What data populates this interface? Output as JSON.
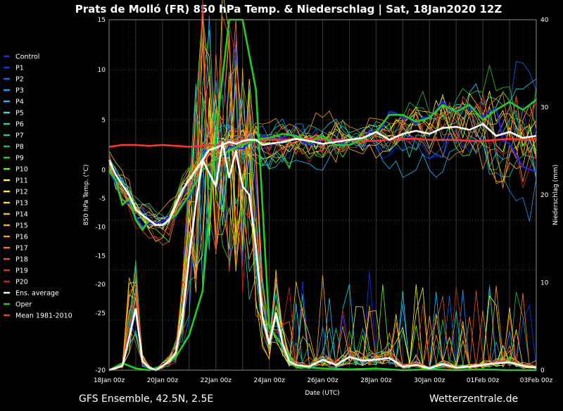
{
  "chart_data": {
    "type": "line",
    "title": "Prats de Molló  (FR)  850 hPa Temp. & Niederschlag | Sat, 18Jan2020 12Z",
    "xlabel": "Date (UTC)",
    "ylabel": "850 hPa Temp. (°C)",
    "y2label": "Niederschlag (mm)",
    "x_ticks": [
      "18Jan 00z",
      "20Jan 00z",
      "22Jan 00z",
      "24Jan 00z",
      "26Jan 00z",
      "28Jan 00z",
      "30Jan 00z",
      "01Feb 00z",
      "03Feb 00z"
    ],
    "x_tick_days": [
      0,
      2,
      4,
      6,
      8,
      10,
      12,
      14,
      16
    ],
    "xlim_days": [
      0,
      16
    ],
    "ylim": [
      -20,
      15
    ],
    "y_ticks": [
      15,
      10,
      5,
      0,
      -5,
      -10,
      -15,
      -20,
      -25,
      -20
    ],
    "y2lim": [
      0,
      40
    ],
    "y2_ticks": [
      0,
      10,
      20,
      30,
      40
    ],
    "grid": true,
    "legend_position": "left",
    "footer_left": "GFS Ensemble, 42.5N, 2.5E",
    "footer_right": "Wetterzentrale.de",
    "series": [
      {
        "name": "Control",
        "color": "#2222ee",
        "width": 2.6
      },
      {
        "name": "P1",
        "color": "#1133ff",
        "width": 0.9
      },
      {
        "name": "P2",
        "color": "#1166ff",
        "width": 0.9
      },
      {
        "name": "P3",
        "color": "#2299ff",
        "width": 0.9
      },
      {
        "name": "P4",
        "color": "#22bbff",
        "width": 0.9
      },
      {
        "name": "P5",
        "color": "#22ddee",
        "width": 0.9
      },
      {
        "name": "P6",
        "color": "#22ddaa",
        "width": 0.9
      },
      {
        "name": "P7",
        "color": "#22cc88",
        "width": 0.9
      },
      {
        "name": "P8",
        "color": "#22bb55",
        "width": 0.9
      },
      {
        "name": "P9",
        "color": "#33cc33",
        "width": 0.9
      },
      {
        "name": "P10",
        "color": "#66ff22",
        "width": 0.9
      },
      {
        "name": "P11",
        "color": "#ffff22",
        "width": 0.9
      },
      {
        "name": "P12",
        "color": "#ffee22",
        "width": 0.9
      },
      {
        "name": "P13",
        "color": "#ffdd22",
        "width": 0.9
      },
      {
        "name": "P14",
        "color": "#ffbb22",
        "width": 0.9
      },
      {
        "name": "P15",
        "color": "#ffaa22",
        "width": 0.9
      },
      {
        "name": "P16",
        "color": "#ff9922",
        "width": 0.9
      },
      {
        "name": "P17",
        "color": "#ff7722",
        "width": 0.9
      },
      {
        "name": "P18",
        "color": "#ee5522",
        "width": 0.9
      },
      {
        "name": "P19",
        "color": "#dd3322",
        "width": 0.9
      },
      {
        "name": "P20",
        "color": "#cc2222",
        "width": 0.9
      },
      {
        "name": "Ens. average",
        "color": "#ffffff",
        "width": 2.6
      },
      {
        "name": "Oper",
        "color": "#22cc22",
        "width": 2.6
      },
      {
        "name": "Mean 1981-2010",
        "color": "#ff3333",
        "width": 2.6
      }
    ],
    "mean_temp": {
      "x": [
        0,
        0.5,
        1,
        1.5,
        2,
        2.5,
        3,
        3.5,
        4,
        4.5,
        5,
        5.5,
        6,
        6.5,
        7,
        7.5,
        8,
        8.5,
        9,
        9.5,
        10,
        10.5,
        11,
        11.5,
        12,
        12.5,
        13,
        13.5,
        14,
        14.5,
        15,
        15.5,
        16
      ],
      "y": [
        2.3,
        2.5,
        2.5,
        2.4,
        2.5,
        2.4,
        2.3,
        2.4,
        2.5,
        2.6,
        2.8,
        2.9,
        3.0,
        3.0,
        3.1,
        3.1,
        3.0,
        3.0,
        3.0,
        2.9,
        2.9,
        3.0,
        3.1,
        3.1,
        3.0,
        3.0,
        3.0,
        2.9,
        2.9,
        3.0,
        3.1,
        3.0,
        3.1
      ]
    },
    "ens_avg_temp": {
      "x": [
        0,
        0.25,
        0.5,
        0.75,
        1,
        1.25,
        1.5,
        1.75,
        2,
        2.25,
        2.5,
        2.75,
        3,
        3.25,
        3.5,
        3.75,
        4,
        4.25,
        4.5,
        4.75,
        5,
        5.25,
        5.5,
        5.75,
        6,
        6.5,
        7,
        7.5,
        8,
        8.5,
        9,
        9.5,
        10,
        10.5,
        11,
        11.5,
        12,
        12.5,
        13,
        13.5,
        14,
        14.5,
        15,
        15.5,
        16
      ],
      "y": [
        1.0,
        -0.5,
        -1.5,
        -2.5,
        -4.0,
        -4.5,
        -5.0,
        -5.5,
        -5.5,
        -5.0,
        -3.5,
        -2.0,
        -1.0,
        0.0,
        1.0,
        2.0,
        2.2,
        2.5,
        2.8,
        2.6,
        2.9,
        3.0,
        3.0,
        2.5,
        2.6,
        2.8,
        3.1,
        2.9,
        2.6,
        2.8,
        3.0,
        3.2,
        3.8,
        3.0,
        3.6,
        3.9,
        3.6,
        4.2,
        4.3,
        4.0,
        4.6,
        3.4,
        3.8,
        3.2,
        3.4
      ]
    },
    "oper_temp": {
      "x": [
        0,
        0.25,
        0.5,
        0.75,
        1,
        1.25,
        1.5,
        1.75,
        2,
        2.5,
        3,
        3.5,
        4,
        4.5,
        5,
        5.5,
        6,
        6.5,
        7,
        7.5,
        8,
        8.5,
        9,
        9.5,
        10,
        10.5,
        11,
        11.5,
        12,
        12.5,
        13,
        13.5,
        14,
        14.5,
        15,
        15.5,
        16
      ],
      "y": [
        0.0,
        -1.0,
        -3.5,
        -2.8,
        -5.0,
        -6.0,
        -5.0,
        -5.5,
        -5.5,
        -4.5,
        -2.5,
        0.0,
        1.0,
        2.0,
        2.5,
        3.0,
        3.2,
        3.6,
        3.4,
        2.8,
        3.4,
        2.5,
        2.5,
        3.1,
        3.8,
        5.5,
        5.5,
        4.8,
        5.2,
        6.5,
        5.8,
        6.5,
        5.0,
        6.0,
        6.8,
        6.0,
        7.0
      ]
    },
    "ens_avg_precip": {
      "x": [
        0,
        0.5,
        1,
        1.25,
        1.5,
        1.75,
        2,
        2.25,
        2.5,
        2.75,
        3,
        3.25,
        3.5,
        4,
        4.25,
        4.5,
        4.75,
        5,
        5.25,
        5.5,
        5.75,
        6,
        6.25,
        6.5,
        6.75,
        7,
        7.5,
        8,
        8.5,
        9,
        9.5,
        10,
        10.5,
        11,
        11.5,
        12,
        12.5,
        13,
        13.5,
        14,
        14.5,
        15,
        15.5,
        16
      ],
      "y": [
        0.0,
        0.5,
        7.0,
        1.0,
        0.3,
        0.0,
        0.5,
        1.0,
        2.0,
        6.0,
        13.0,
        19.0,
        24.0,
        21.0,
        26.0,
        22.0,
        25.0,
        21.0,
        20.0,
        14.0,
        6.0,
        3.0,
        6.5,
        3.0,
        1.0,
        0.6,
        0.4,
        1.2,
        0.6,
        1.5,
        1.1,
        1.2,
        1.4,
        0.4,
        0.6,
        0.2,
        0.7,
        0.3,
        0.4,
        0.6,
        0.8,
        0.9,
        0.5,
        0.3
      ]
    },
    "oper_precip": {
      "x": [
        0,
        0.5,
        1,
        1.5,
        2,
        2.5,
        3,
        3.5,
        4,
        4.5,
        5,
        5.5,
        6,
        7,
        8,
        9,
        10,
        11,
        12,
        13,
        14,
        15,
        16
      ],
      "y": [
        0.0,
        0.8,
        0.2,
        0.0,
        0.5,
        1.5,
        4.0,
        9.0,
        27.0,
        40.0,
        40.0,
        32.0,
        5.0,
        0.4,
        0.2,
        0.1,
        0.2,
        0.0,
        0.1,
        0.0,
        0.1,
        0.0,
        0.0
      ]
    }
  }
}
